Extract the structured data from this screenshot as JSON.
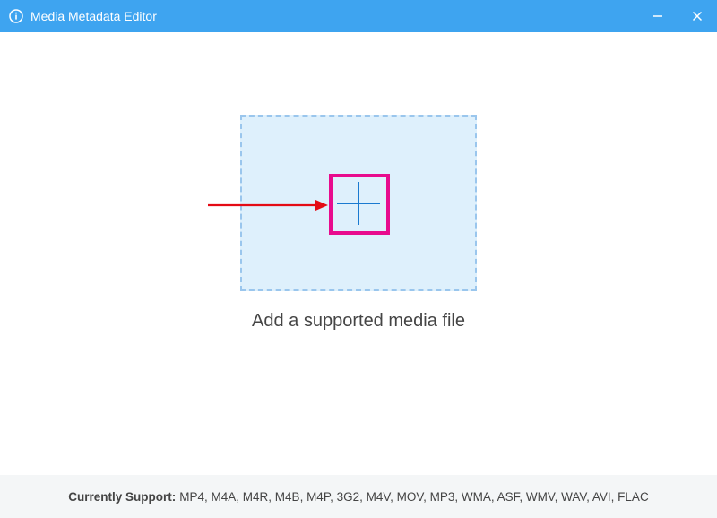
{
  "titlebar": {
    "title": "Media Metadata Editor"
  },
  "main": {
    "prompt": "Add a supported media file"
  },
  "footer": {
    "prefix": "Currently Support:",
    "formats": "MP4, M4A, M4R, M4B, M4P, 3G2, M4V, MOV, MP3, WMA, ASF, WMV, WAV, AVI, FLAC"
  },
  "annotations": {
    "highlight_color": "#e80b8d",
    "arrow_color": "#e40b15"
  }
}
